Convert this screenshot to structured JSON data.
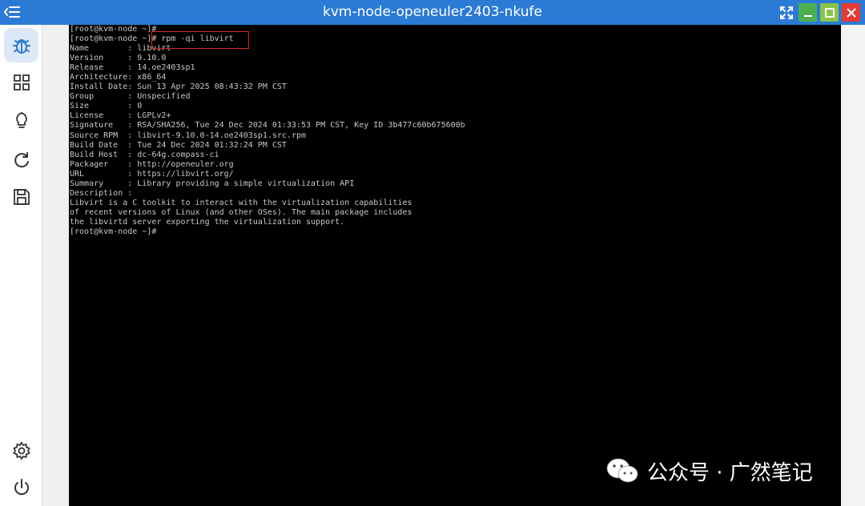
{
  "window": {
    "title": "kvm-node-openeuler2403-nkufe"
  },
  "sidebar": {
    "items": [
      {
        "icon": "bug-icon",
        "active": true
      },
      {
        "icon": "grid-icon",
        "active": false
      },
      {
        "icon": "lightbulb-icon",
        "active": false
      },
      {
        "icon": "refresh-icon",
        "active": false
      },
      {
        "icon": "save-icon",
        "active": false
      },
      {
        "icon": "gear-icon",
        "active": false
      },
      {
        "icon": "power-icon",
        "active": false
      }
    ]
  },
  "terminal": {
    "lines": [
      "[root@kvm-node ~]#",
      "[root@kvm-node ~]# rpm -qi libvirt",
      "Name        : libvirt",
      "Version     : 9.10.0",
      "Release     : 14.oe2403sp1",
      "Architecture: x86_64",
      "Install Date: Sun 13 Apr 2025 08:43:32 PM CST",
      "Group       : Unspecified",
      "Size        : 0",
      "License     : LGPLv2+",
      "Signature   : RSA/SHA256, Tue 24 Dec 2024 01:33:53 PM CST, Key ID 3b477c60b675600b",
      "Source RPM  : libvirt-9.10.0-14.oe2403sp1.src.rpm",
      "Build Date  : Tue 24 Dec 2024 01:32:24 PM CST",
      "Build Host  : dc-64g.compass-ci",
      "Packager    : http://openeuler.org",
      "URL         : https://libvirt.org/",
      "Summary     : Library providing a simple virtualization API",
      "Description :",
      "Libvirt is a C toolkit to interact with the virtualization capabilities",
      "of recent versions of Linux (and other OSes). The main package includes",
      "the libvirtd server exporting the virtualization support.",
      "[root@kvm-node ~]#"
    ]
  },
  "watermark": {
    "text": "公众号 · 广然笔记",
    "icon": "wechat-icon"
  },
  "colors": {
    "titlebar": "#2b7bd6",
    "accent": "#2b7bd6",
    "highlight": "#d9262c"
  }
}
